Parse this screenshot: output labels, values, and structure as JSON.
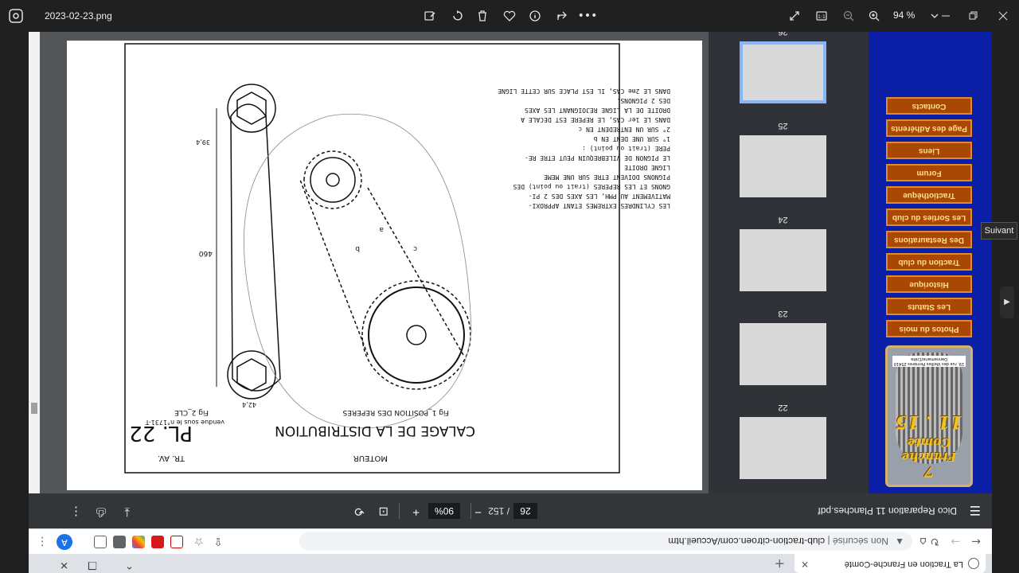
{
  "viewer": {
    "file_name": "2023-02-23.png",
    "zoom": "94 %",
    "next_tooltip": "Suivant"
  },
  "browser": {
    "tab_title": "La Traction en Franche-Comté",
    "security_label": "Non sécurisé",
    "url": "club-traction-citroen.com/Accueil.htm",
    "profile_initial": "A"
  },
  "pdf": {
    "title": "Dico Reparation 11 Planches.pdf",
    "current_page": "26",
    "total_pages": "/ 152",
    "zoom": "90%"
  },
  "club": {
    "logo_line1": "7",
    "logo_line2": "Franche",
    "logo_line3": "Comte",
    "logo_line4": "11 . 15",
    "logo_address": "19, rue des Vieilles Perrières 25410 Dannemarie/Crête",
    "nav_items": [
      "Photos du mois",
      "Les Statuts",
      "Historique",
      "Traction du club",
      "Des Restaurations",
      "Les Sorties du club",
      "Tractiothèque",
      "Forum",
      "Liens",
      "Page des Adhérents",
      "Contacts"
    ]
  },
  "thumbnails": [
    {
      "label": "22"
    },
    {
      "label": "23"
    },
    {
      "label": "24"
    },
    {
      "label": "25"
    },
    {
      "label": "26"
    }
  ],
  "drawing": {
    "tr_av": "TR. AV.",
    "moteur": "MOTEUR",
    "pl": "PL. 22",
    "calage": "CALAGE DE LA DISTRIBUTION",
    "fig1": "Fig 1_POSITION DES REPERES",
    "fig2": "Fig 2_CLE",
    "vendue": "vendue sous le n°1731-T",
    "dim_460": "460",
    "dim_42": "42,4",
    "dim_39": "39,4",
    "label_a": "a",
    "label_b": "b",
    "label_c": "c",
    "notes": [
      "LES CYLINDRES EXTREMES ETANT APPROXI-",
      "MATIVEMENT AU PMH, LES AXES DES 2 PI-",
      "GNONS ET LES REPERES (trait ou point) DES",
      "PIGNONS DOIVENT ETRE SUR UNE MEME",
      "LIGNE DROITE",
      "LE PIGNON DE VILEBREQUIN PEUT ETRE RE-",
      "PERE (trait ou point) :",
      "1° SUR UNE DENT EN b",
      "2° SUR UN ENTREDENT EN c",
      "DANS LE 1er CAS, LE REPERE EST DECALE A",
      "DROITE DE LA LIGNE REJOIGNANT LES AXES",
      "DES 2 PIGNONS.",
      "DANS LE 2me CAS, IL EST PLACE SUR CETTE LIGNE"
    ]
  }
}
